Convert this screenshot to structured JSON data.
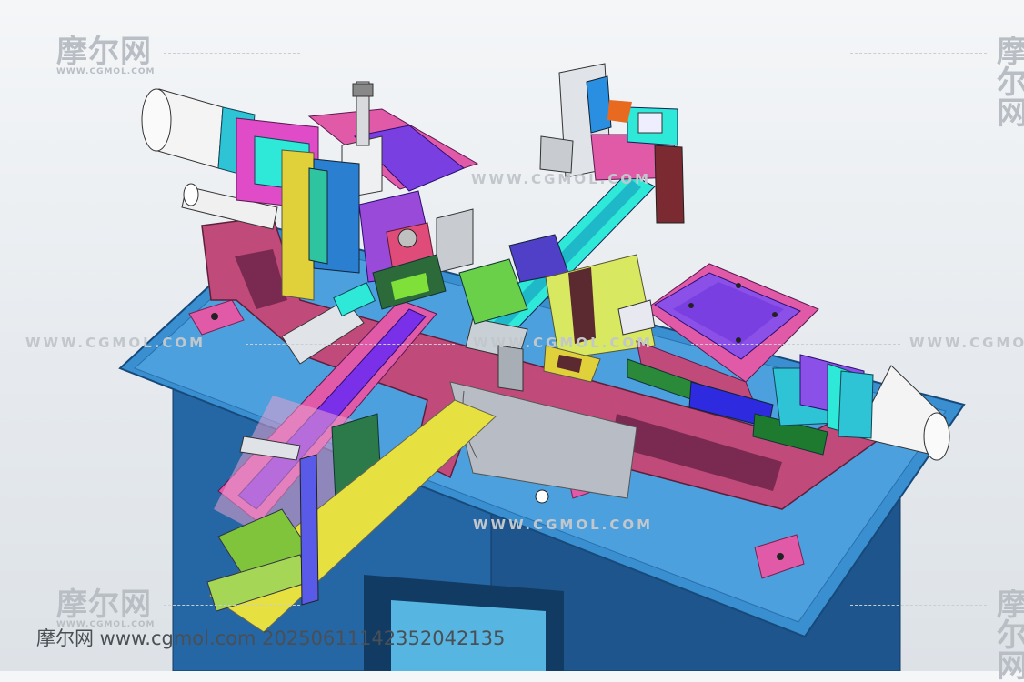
{
  "watermark": {
    "brand": "摩尔网",
    "domain_caps": "WWW.CGMOL.COM",
    "domain_lower": "www.cgmol.com"
  },
  "footer": {
    "text": "摩尔网 www.cgmol.com 20250611142352042135"
  },
  "colors": {
    "background": "#e9edf1",
    "table_top": "#3a8fd0",
    "table_body": "#1f5f99",
    "frame": "#c04a7a",
    "slide_cyan": "#2ee8d8",
    "plate_purple": "#7a3fe0",
    "magenta": "#e04cc8",
    "yellow": "#e6e040",
    "green": "#7fc43a",
    "cylinder_white": "#f4f4f4"
  }
}
